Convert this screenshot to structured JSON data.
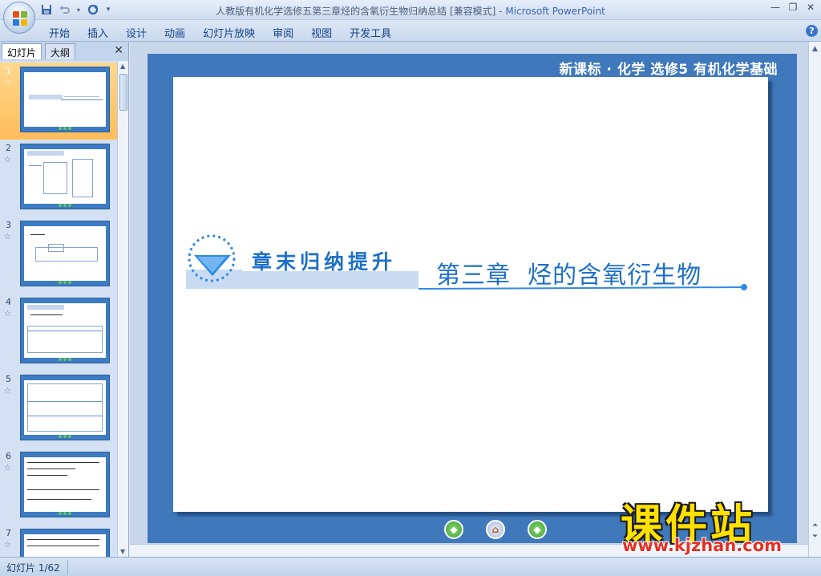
{
  "window": {
    "title": "人教版有机化学选修五第三章烃的含氧衍生物归纳总结 [兼容模式]",
    "title_sep": " - ",
    "app_name": "Microsoft PowerPoint",
    "controls": [
      "minimize-icon",
      "restore-icon",
      "close-icon"
    ]
  },
  "quick_access": [
    "save-icon",
    "undo-icon",
    "redo-icon",
    "customize-icon"
  ],
  "ribbon": {
    "tabs": [
      "开始",
      "插入",
      "设计",
      "动画",
      "幻灯片放映",
      "审阅",
      "视图",
      "开发工具"
    ],
    "help": "?"
  },
  "left_pane": {
    "tabs": [
      "幻灯片",
      "大纲"
    ],
    "close": "✕",
    "thumbnails": [
      {
        "number": "1",
        "selected": true
      },
      {
        "number": "2"
      },
      {
        "number": "3"
      },
      {
        "number": "4"
      },
      {
        "number": "5"
      },
      {
        "number": "6"
      },
      {
        "number": "7"
      }
    ],
    "star_icon": "☆"
  },
  "slide": {
    "header": "新课标 · 化学  选修5  有机化学基础",
    "banner_label": "章末归纳提升",
    "chapter_title": "第三章  烃的含氧衍生物"
  },
  "nav_buttons": [
    "previous-icon",
    "home-icon",
    "next-icon"
  ],
  "watermark": {
    "title": "课件站",
    "url": "www.kjzhan.com"
  },
  "status": {
    "slide_counter": "幻灯片 1/62"
  },
  "colors": {
    "slide_frame": "#3f79bb",
    "accent_blue": "#2f8be0",
    "selected_thumb": "#ffbd5a",
    "watermark_yellow": "#ffe000",
    "watermark_red": "#e53025"
  }
}
